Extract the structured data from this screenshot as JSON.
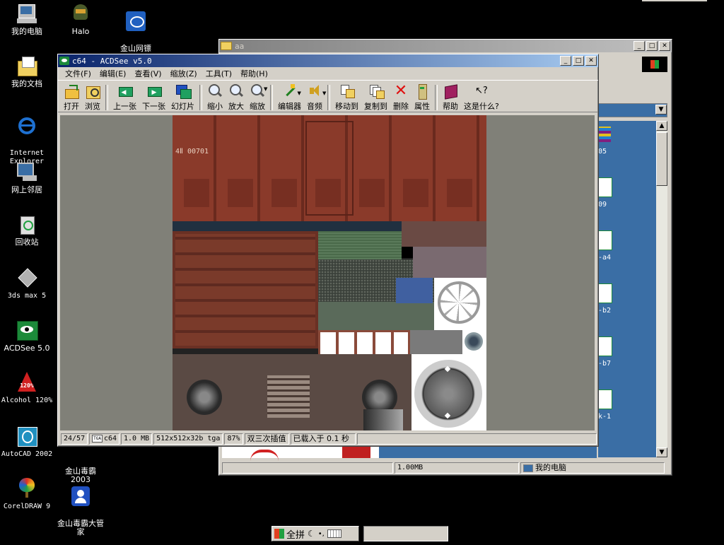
{
  "desktop_icons": [
    {
      "label": "我的电脑",
      "icon": "my-computer-icon"
    },
    {
      "label": "Halo",
      "icon": "halo-game-icon"
    },
    {
      "label": "金山网镖\n2003",
      "icon": "kingsoft-firewall-icon"
    },
    {
      "label": "我的文档",
      "icon": "my-documents-icon"
    },
    {
      "label": "Internet\nExplorer",
      "icon": "internet-explorer-icon"
    },
    {
      "label": "网上邻居",
      "icon": "network-places-icon"
    },
    {
      "label": "回收站",
      "icon": "recycle-bin-icon"
    },
    {
      "label": "3ds max 5",
      "icon": "3ds-max-icon"
    },
    {
      "label": "ACDSee 5.0",
      "icon": "acdsee-icon"
    },
    {
      "label": "Alcohol 120%",
      "icon": "alcohol-icon"
    },
    {
      "label": "AutoCAD 2002",
      "icon": "autocad-icon"
    },
    {
      "label": "金山毒霸\n2003",
      "icon": "kingsoft-antivirus-icon"
    },
    {
      "label": "CorelDRAW 9",
      "icon": "coreldraw-icon"
    },
    {
      "label": "金山毒霸大管\n家",
      "icon": "kingsoft-manager-icon"
    }
  ],
  "back_window": {
    "title": "aa",
    "status": {
      "size": "1.00MB",
      "location": "我的电脑"
    },
    "file_labels": [
      "05",
      "09",
      "-a4",
      "-b2",
      "-b7",
      "k-1"
    ]
  },
  "acdsee": {
    "title": "c64 - ACDSee v5.0",
    "menu": [
      "文件(F)",
      "编辑(E)",
      "查看(V)",
      "缩放(Z)",
      "工具(T)",
      "帮助(H)"
    ],
    "toolbar": [
      {
        "label": "打开",
        "icon": "open-folder-icon"
      },
      {
        "label": "浏览",
        "icon": "browse-icon"
      },
      {
        "label": "上一张",
        "icon": "previous-arrow-icon"
      },
      {
        "label": "下一张",
        "icon": "next-arrow-icon"
      },
      {
        "label": "幻灯片",
        "icon": "slideshow-icon"
      },
      {
        "label": "缩小",
        "icon": "zoom-out-icon"
      },
      {
        "label": "放大",
        "icon": "zoom-in-icon"
      },
      {
        "label": "缩放",
        "icon": "zoom-icon"
      },
      {
        "label": "编辑器",
        "icon": "editor-wand-icon"
      },
      {
        "label": "音频",
        "icon": "audio-speaker-icon"
      },
      {
        "label": "移动到",
        "icon": "move-to-icon"
      },
      {
        "label": "复制到",
        "icon": "copy-to-icon"
      },
      {
        "label": "删除",
        "icon": "delete-x-icon"
      },
      {
        "label": "属性",
        "icon": "properties-icon"
      },
      {
        "label": "帮助",
        "icon": "help-book-icon"
      },
      {
        "label": "这是什么?",
        "icon": "whats-this-icon"
      }
    ],
    "status": {
      "index": "24/57",
      "format_badge": "TGA",
      "name": "c64",
      "size": "1.0 MB",
      "dims": "512x512x32b tga",
      "zoom": "87%",
      "resample": "双三次插值",
      "load": "已载入于 0.1 秒"
    }
  },
  "taskbar": {
    "ime_label": "全拼"
  },
  "colors": {
    "desktop": "#000000",
    "title_active": "#0a246a",
    "window_face": "#d4d0c8",
    "viewer_bg": "#808078",
    "explorer_blue": "#3a6ea5"
  }
}
